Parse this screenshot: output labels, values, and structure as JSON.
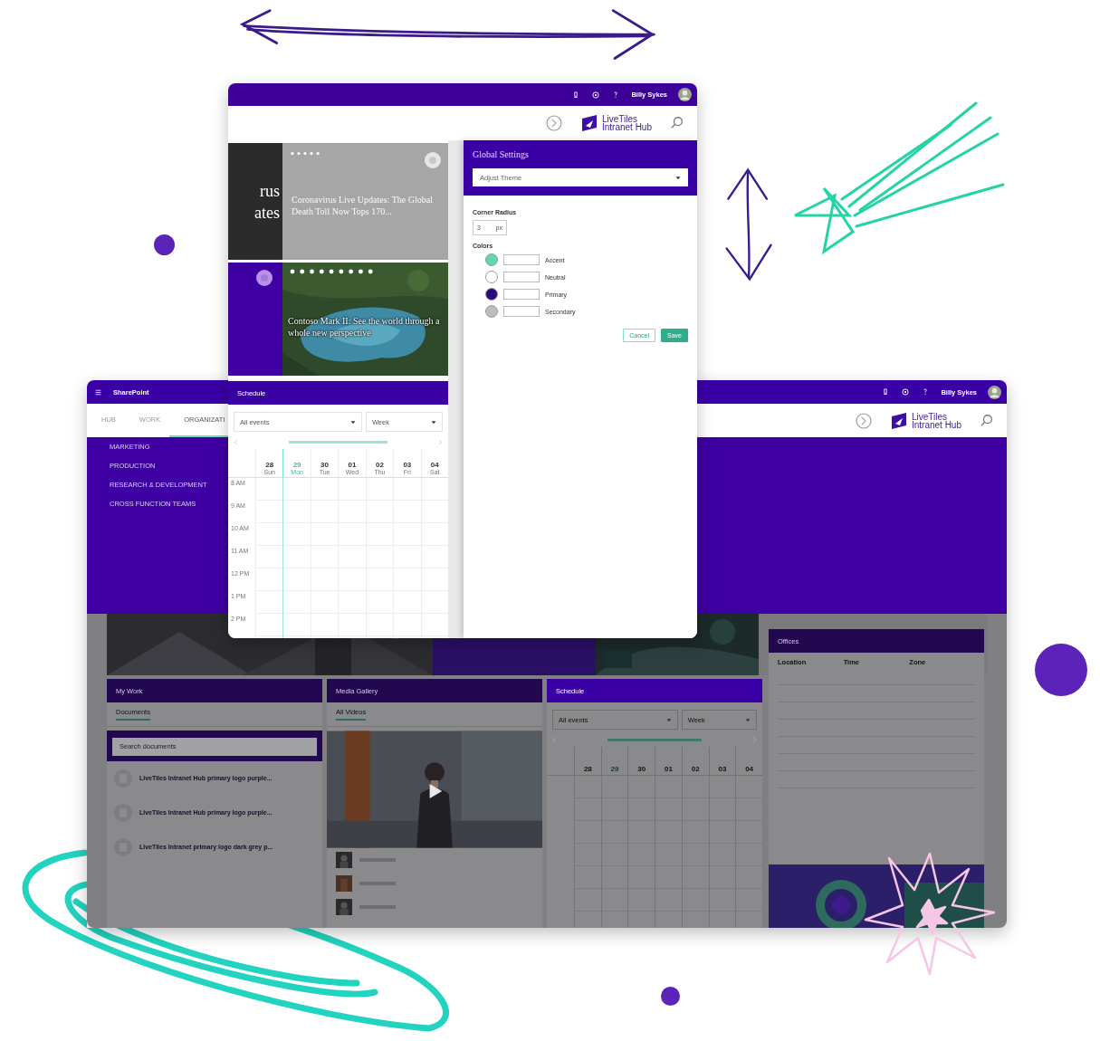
{
  "back_window": {
    "top_bar": {
      "app": "SharePoint",
      "user": "Billy Sykes"
    },
    "logo": {
      "line1": "LiveTiles",
      "line2": "Intranet Hub"
    },
    "tabs": [
      {
        "label": "HUB",
        "selected": false
      },
      {
        "label": "WORK",
        "selected": false
      },
      {
        "label": "ORGANIZATI",
        "selected": true
      }
    ],
    "menu": [
      "MARKETING",
      "PRODUCTION",
      "RESEARCH & DEVELOPMENT",
      "CROSS FUNCTION TEAMS"
    ],
    "my_work": {
      "title": "My Work",
      "tabs": [
        {
          "label": "Documents",
          "selected": true
        }
      ],
      "search": {
        "placeholder": "Search documents"
      },
      "documents": [
        {
          "title": "LiveTiles Intranet Hub primary logo purple..."
        },
        {
          "title": "LiveTiles Intranet Hub primary logo purple..."
        },
        {
          "title": "LiveTiles Intranet primary logo dark grey p..."
        }
      ]
    },
    "media_gallery": {
      "title": "Media Gallery",
      "tabs": [
        {
          "label": "All Videos",
          "selected": true
        }
      ]
    },
    "schedule": {
      "title": "Schedule",
      "filters": [
        "All events",
        "Week"
      ],
      "days": [
        {
          "date": "28",
          "selected": false
        },
        {
          "date": "29",
          "selected": true
        },
        {
          "date": "30",
          "selected": false
        },
        {
          "date": "01",
          "selected": false
        },
        {
          "date": "02",
          "selected": false
        },
        {
          "date": "03",
          "selected": false
        },
        {
          "date": "04",
          "selected": false
        }
      ]
    },
    "offices": {
      "title": "Offices",
      "columns": [
        "Location",
        "Time",
        "Zone"
      ]
    }
  },
  "front_window": {
    "top_bar": {
      "user": "Billy Sykes"
    },
    "logo": {
      "line1": "LiveTiles",
      "line2": "Intranet Hub"
    },
    "hero": {
      "cut_title": [
        "rus",
        "ates"
      ],
      "tiles": [
        {
          "headline": "Coronavirus Live Updates: The Global Death Toll Now Tops 170..."
        },
        {
          "headline": "Contoso Mark II: See the world through a whole new perspective"
        }
      ]
    },
    "schedule": {
      "title": "Schedule",
      "filters": [
        "All events",
        "Week"
      ],
      "days": [
        {
          "date": "28",
          "weekday": "Sun",
          "selected": false
        },
        {
          "date": "29",
          "weekday": "Mon",
          "selected": true
        },
        {
          "date": "30",
          "weekday": "Tue",
          "selected": false
        },
        {
          "date": "01",
          "weekday": "Wed",
          "selected": false
        },
        {
          "date": "02",
          "weekday": "Thu",
          "selected": false
        },
        {
          "date": "03",
          "weekday": "Fri",
          "selected": false
        },
        {
          "date": "04",
          "weekday": "Sat",
          "selected": false
        }
      ],
      "times": [
        "8 AM",
        "9 AM",
        "10 AM",
        "11 AM",
        "12 PM",
        "1 PM",
        "2 PM"
      ]
    },
    "settings": {
      "title": "Global Settings",
      "theme_select": "Adjust Theme",
      "corner_radius": {
        "label": "Corner Radius",
        "value": "3",
        "unit": "px"
      },
      "colors_label": "Colors",
      "colors": [
        {
          "label": "Accent",
          "color": "#5fd6b6"
        },
        {
          "label": "Neutral",
          "color": "#ffffff"
        },
        {
          "label": "Primary",
          "color": "#2a0a7c"
        },
        {
          "label": "Secondary",
          "color": "#bdbdbd"
        }
      ],
      "buttons": [
        "Cancel",
        "Save"
      ]
    }
  }
}
